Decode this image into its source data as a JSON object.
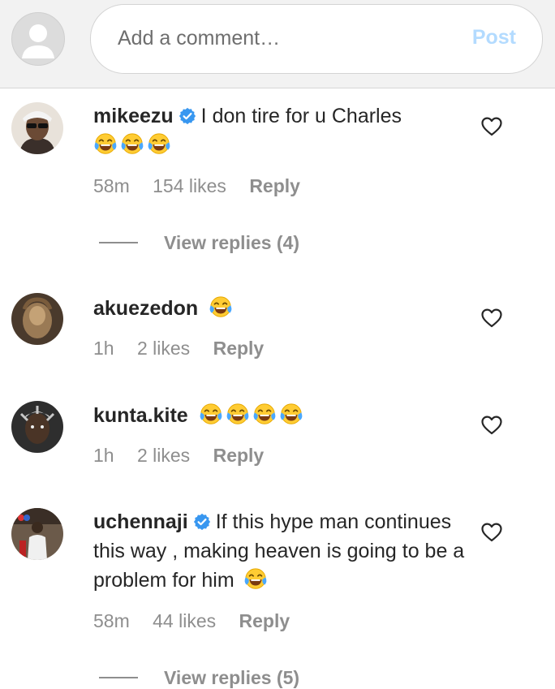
{
  "input": {
    "placeholder": "Add a comment…",
    "post_label": "Post"
  },
  "colors": {
    "post_disabled": "#b3dbff",
    "verified": "#3897f0",
    "muted": "#8e8e8e"
  },
  "comments": [
    {
      "username": "mikeezu",
      "verified": true,
      "text": "I don tire for u Charles",
      "emoji_count": 3,
      "time": "58m",
      "likes": "154 likes",
      "reply": "Reply",
      "view_replies": "View replies (4)"
    },
    {
      "username": "akuezedon",
      "verified": false,
      "text": "",
      "emoji_count": 1,
      "time": "1h",
      "likes": "2 likes",
      "reply": "Reply"
    },
    {
      "username": "kunta.kite",
      "verified": false,
      "text": "",
      "emoji_count": 4,
      "time": "1h",
      "likes": "2 likes",
      "reply": "Reply"
    },
    {
      "username": "uchennaji",
      "verified": true,
      "text": "If this hype man continues this way , making heaven is going to be a problem for him",
      "emoji_count": 1,
      "time": "58m",
      "likes": "44 likes",
      "reply": "Reply",
      "view_replies": "View replies (5)"
    }
  ]
}
